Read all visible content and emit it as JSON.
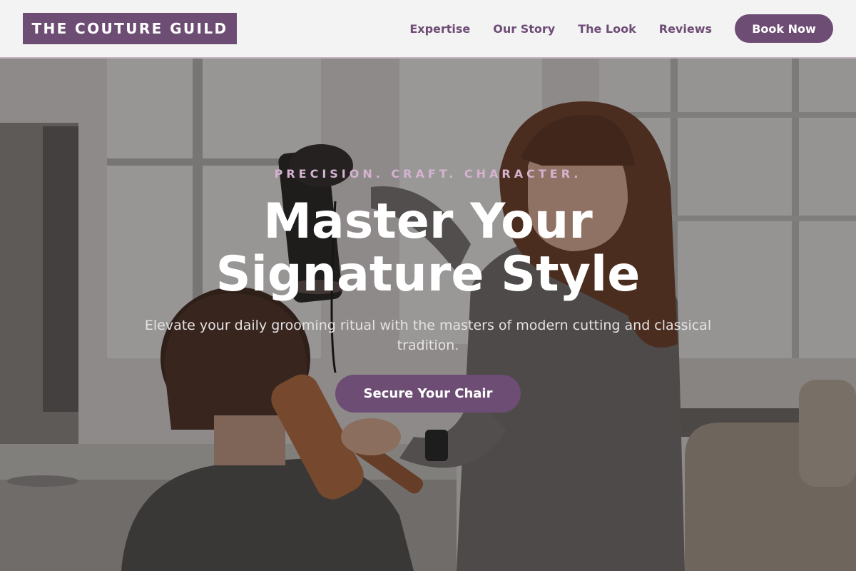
{
  "header": {
    "logo": "THE COUTURE GUILD",
    "nav": [
      {
        "label": "Expertise"
      },
      {
        "label": "Our Story"
      },
      {
        "label": "The Look"
      },
      {
        "label": "Reviews"
      }
    ],
    "cta_label": "Book Now"
  },
  "hero": {
    "tagline": "PRECISION. CRAFT. CHARACTER.",
    "title_line1": "Master Your",
    "title_line2": "Signature Style",
    "subtitle": "Elevate your daily grooming ritual with the masters of modern cutting and classical tradition.",
    "cta_label": "Secure Your Chair",
    "image_description_icon": "salon-photo"
  },
  "colors": {
    "brand": "#6e4d75",
    "tagline": "#d5b3d0",
    "header_bg": "#f4f3f4"
  }
}
